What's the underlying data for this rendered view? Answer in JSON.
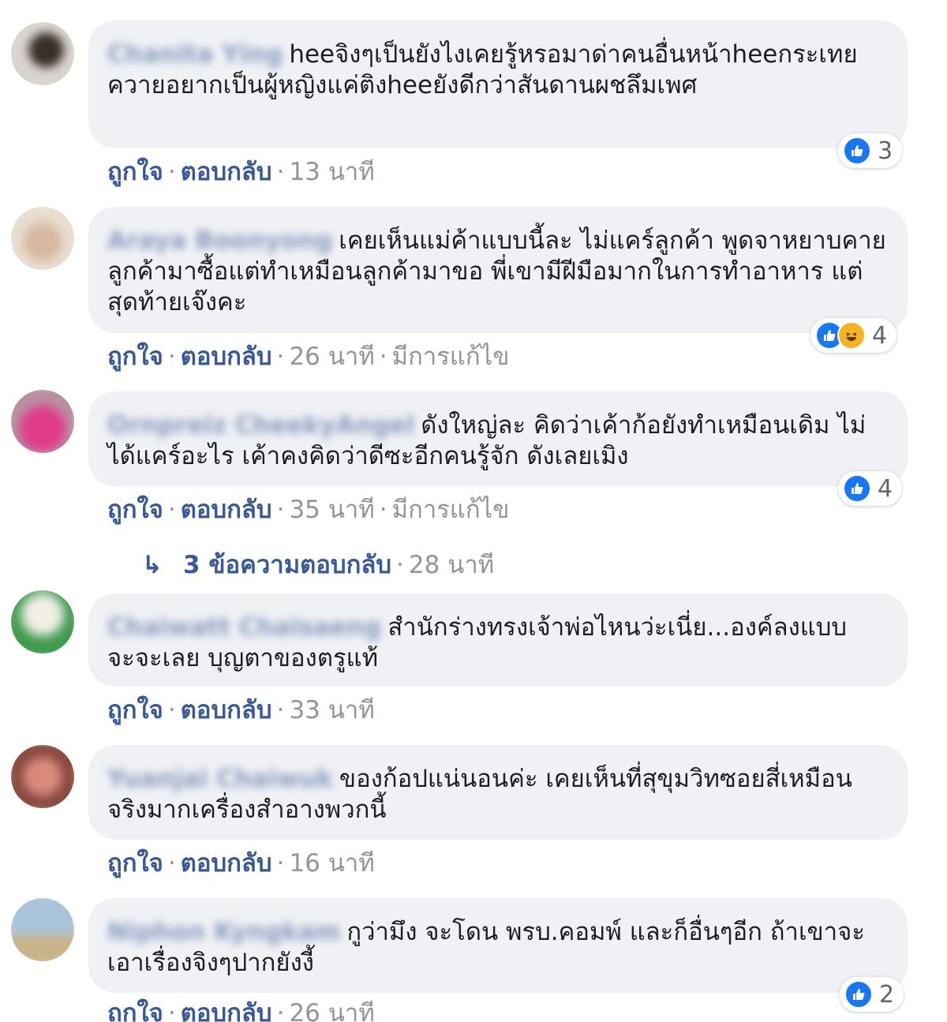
{
  "labels": {
    "like": "ถูกใจ",
    "reply": "ตอบกลับ",
    "separator": "·",
    "edited": "มีการแก้ไข",
    "reply_arrow": "↳"
  },
  "colors": {
    "link": "#385898",
    "bubble": "#eff1f4",
    "meta": "#90949c",
    "like": "#1877f2",
    "haha": "#f7b125"
  },
  "comments": [
    {
      "author": "Chanita Ying",
      "text": "heeจิงๆเป็นยังไงเคยรู้หรอมาด่าคนอื่นหน้าheeกระเทยควายอยากเป็นผู้หญิงแค่ติงheeยังดีกว่าสันดานผชลึมเพศ",
      "time": "13 นาที",
      "reaction_icons": [
        "like-icon"
      ],
      "reaction_count": "3"
    },
    {
      "author": "Araya Boonyong",
      "text": "เคยเห็นแม่ค้าแบบนี้ละ ไม่แคร์ลูกค้า พูดจาหยาบคาย ลูกค้ามาซื้อแต่ทำเหมือนลูกค้ามาขอ พี่เขามีฝีมือมากในการทำอาหาร แต่สุดท้ายเจ๊งคะ",
      "time": "26 นาที",
      "edited": true,
      "reaction_icons": [
        "like-icon",
        "haha-icon"
      ],
      "reaction_count": "4"
    },
    {
      "author": "Ornpreiz CheekyAngel",
      "text": "ดังใหญ่ละ คิดว่าเค้าก้อยังทำเหมือนเดิม ไม่ได้แคร์อะไร เค้าคงคิดว่าดีซะอีกคนรู้จัก ดังเลยเมิง",
      "time": "35 นาที",
      "edited": true,
      "reaction_icons": [
        "like-icon"
      ],
      "reaction_count": "4",
      "replies_link": "3 ข้อความตอบกลับ",
      "replies_time": "28 นาที"
    },
    {
      "author": "Chaiwatt Chaisaeng",
      "text": "สำนักร่างทรงเจ้าพ่อไหนว่ะเนี่ย...องค์ลงแบบจะจะเลย บุญตาของตรูแท้",
      "time": "33 นาที"
    },
    {
      "author": "Yuanjai Chaiwuk",
      "text": "ของก้อปแน่นอนค่ะ เคยเห็นที่สุขุมวิทซอยสี่เหมือนจริงมากเครื่องสำอางพวกนี้",
      "time": "16 นาที"
    },
    {
      "author": "Niphon Kyngkam",
      "text": "กูว่ามึง จะโดน พรบ.คอมพ์ และก็อื่นๆอีก ถ้าเขาจะเอาเรื่องจิงๆปากยังงี้",
      "time": "26 นาที",
      "reaction_icons": [
        "like-icon"
      ],
      "reaction_count": "2"
    }
  ]
}
